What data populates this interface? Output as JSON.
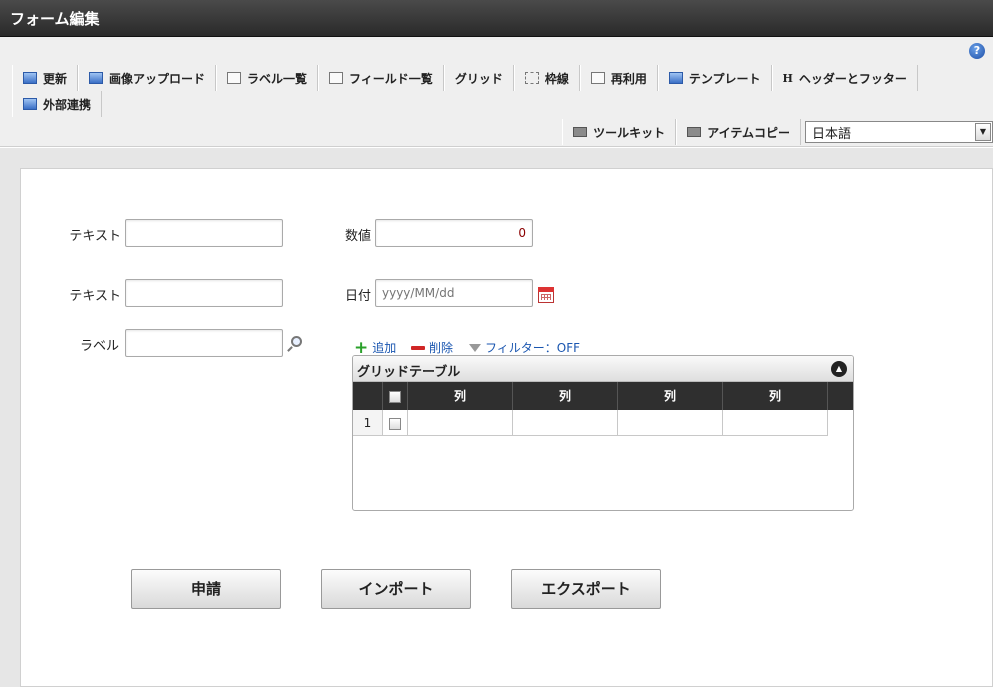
{
  "window": {
    "title": "フォーム編集"
  },
  "toolbar": {
    "row1": [
      {
        "label": "更新",
        "icon": "refresh-icon"
      },
      {
        "label": "画像アップロード",
        "icon": "image-upload-icon"
      },
      {
        "label": "ラベル一覧",
        "icon": "label-list-icon"
      },
      {
        "label": "フィールド一覧",
        "icon": "field-list-icon"
      },
      {
        "label": "グリッド",
        "icon": "grid-icon"
      },
      {
        "label": "枠線",
        "icon": "border-icon"
      },
      {
        "label": "再利用",
        "icon": "reuse-icon"
      },
      {
        "label": "テンプレート",
        "icon": "template-icon"
      },
      {
        "label": "ヘッダーとフッター",
        "icon": "header-footer-icon"
      }
    ],
    "row2": [
      {
        "label": "外部連携",
        "icon": "external-link-icon"
      }
    ],
    "row3": [
      {
        "label": "ツールキット",
        "icon": "toolkit-icon"
      },
      {
        "label": "アイテムコピー",
        "icon": "item-copy-icon"
      }
    ],
    "language": {
      "selected": "日本語"
    }
  },
  "form": {
    "text1_label": "テキスト",
    "text2_label": "テキスト",
    "number_label": "数値",
    "number_value": "0",
    "date_label": "日付",
    "date_placeholder": "yyyy/MM/dd",
    "label_label": "ラベル"
  },
  "grid": {
    "add": "追加",
    "delete": "削除",
    "filter": "フィルター：OFF",
    "title": "グリッドテーブル",
    "columns": [
      "列",
      "列",
      "列",
      "列"
    ],
    "rows": [
      {
        "num": "1"
      }
    ]
  },
  "buttons": {
    "apply": "申請",
    "import": "インポート",
    "export": "エクスポート"
  }
}
